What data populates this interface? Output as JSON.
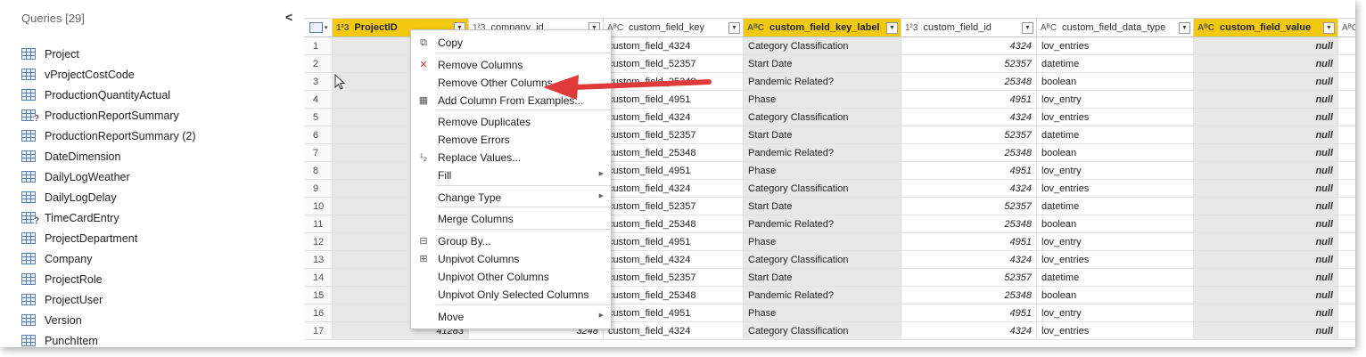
{
  "queries": {
    "header": "Queries [29]",
    "collapse_glyph": "<",
    "items": [
      {
        "label": "Project",
        "icon": "table-icon"
      },
      {
        "label": "vProjectCostCode",
        "icon": "table-icon"
      },
      {
        "label": "ProductionQuantityActual",
        "icon": "table-icon"
      },
      {
        "label": "ProductionReportSummary",
        "icon": "parameter-table-icon"
      },
      {
        "label": "ProductionReportSummary (2)",
        "icon": "table-icon"
      },
      {
        "label": "DateDimension",
        "icon": "table-icon"
      },
      {
        "label": "DailyLogWeather",
        "icon": "table-icon"
      },
      {
        "label": "DailyLogDelay",
        "icon": "table-icon"
      },
      {
        "label": "TimeCardEntry",
        "icon": "parameter-table-icon"
      },
      {
        "label": "ProjectDepartment",
        "icon": "table-icon"
      },
      {
        "label": "Company",
        "icon": "table-icon"
      },
      {
        "label": "ProjectRole",
        "icon": "table-icon"
      },
      {
        "label": "ProjectUser",
        "icon": "table-icon"
      },
      {
        "label": "Version",
        "icon": "table-icon"
      },
      {
        "label": "PunchItem",
        "icon": "table-icon"
      }
    ]
  },
  "grid": {
    "columns": [
      {
        "type": "1²3",
        "name": "ProjectID",
        "selected": true
      },
      {
        "type": "1²3",
        "name": "company_id",
        "selected": false
      },
      {
        "type": "AᴮC",
        "name": "custom_field_key",
        "selected": false
      },
      {
        "type": "AᴮC",
        "name": "custom_field_key_label",
        "selected": true
      },
      {
        "type": "1²3",
        "name": "custom_field_id",
        "selected": false
      },
      {
        "type": "AᴮC",
        "name": "custom_field_data_type",
        "selected": false
      },
      {
        "type": "AᴮC",
        "name": "custom_field_value",
        "selected": true
      },
      {
        "type": "AᴮC",
        "name": "",
        "selected": false
      }
    ],
    "rows": [
      {
        "n": "1",
        "key": "custom_field_4324",
        "label": "Category Classification",
        "id": "4324",
        "dtype": "lov_entries",
        "value": "null"
      },
      {
        "n": "2",
        "key": "custom_field_52357",
        "label": "Start Date",
        "id": "52357",
        "dtype": "datetime",
        "value": "null"
      },
      {
        "n": "3",
        "key": "custom_field_25348",
        "label": "Pandemic Related?",
        "id": "25348",
        "dtype": "boolean",
        "value": "null"
      },
      {
        "n": "4",
        "key": "custom_field_4951",
        "label": "Phase",
        "id": "4951",
        "dtype": "lov_entry",
        "value": "null"
      },
      {
        "n": "5",
        "key": "custom_field_4324",
        "label": "Category Classification",
        "id": "4324",
        "dtype": "lov_entries",
        "value": "null"
      },
      {
        "n": "6",
        "key": "custom_field_52357",
        "label": "Start Date",
        "id": "52357",
        "dtype": "datetime",
        "value": "null"
      },
      {
        "n": "7",
        "key": "custom_field_25348",
        "label": "Pandemic Related?",
        "id": "25348",
        "dtype": "boolean",
        "value": "null"
      },
      {
        "n": "8",
        "key": "custom_field_4951",
        "label": "Phase",
        "id": "4951",
        "dtype": "lov_entry",
        "value": "null"
      },
      {
        "n": "9",
        "key": "custom_field_4324",
        "label": "Category Classification",
        "id": "4324",
        "dtype": "lov_entries",
        "value": "null"
      },
      {
        "n": "10",
        "key": "custom_field_52357",
        "label": "Start Date",
        "id": "52357",
        "dtype": "datetime",
        "value": "null"
      },
      {
        "n": "11",
        "key": "custom_field_25348",
        "label": "Pandemic Related?",
        "id": "25348",
        "dtype": "boolean",
        "value": "null"
      },
      {
        "n": "12",
        "key": "custom_field_4951",
        "label": "Phase",
        "id": "4951",
        "dtype": "lov_entry",
        "value": "null"
      },
      {
        "n": "13",
        "key": "custom_field_4324",
        "label": "Category Classification",
        "id": "4324",
        "dtype": "lov_entries",
        "value": "null"
      },
      {
        "n": "14",
        "key": "custom_field_52357",
        "label": "Start Date",
        "id": "52357",
        "dtype": "datetime",
        "value": "null"
      },
      {
        "n": "15",
        "key": "custom_field_25348",
        "label": "Pandemic Related?",
        "id": "25348",
        "dtype": "boolean",
        "value": "null"
      },
      {
        "n": "16",
        "key": "custom_field_4951",
        "label": "Phase",
        "id": "4951",
        "dtype": "lov_entry",
        "value": "null"
      },
      {
        "n": "17",
        "project": "41283",
        "company": "3248",
        "key": "custom_field_4324",
        "label": "Category Classification",
        "id": "4324",
        "dtype": "lov_entries",
        "value": "null"
      }
    ]
  },
  "context_menu": {
    "items": [
      {
        "label": "Copy",
        "icon": "copy-icon",
        "submenu": false
      },
      {
        "label": "Remove Columns",
        "icon": "remove-columns-icon",
        "submenu": false
      },
      {
        "label": "Remove Other Columns",
        "icon": "",
        "submenu": false
      },
      {
        "label": "Add Column From Examples...",
        "icon": "add-column-examples-icon",
        "submenu": false
      },
      {
        "label": "Remove Duplicates",
        "icon": "",
        "submenu": false
      },
      {
        "label": "Remove Errors",
        "icon": "",
        "submenu": false
      },
      {
        "label": "Replace Values...",
        "icon": "replace-values-icon",
        "submenu": false
      },
      {
        "label": "Fill",
        "icon": "",
        "submenu": true
      },
      {
        "label": "Change Type",
        "icon": "",
        "submenu": true
      },
      {
        "label": "Merge Columns",
        "icon": "",
        "submenu": false
      },
      {
        "label": "Group By...",
        "icon": "group-by-icon",
        "submenu": false
      },
      {
        "label": "Unpivot Columns",
        "icon": "unpivot-columns-icon",
        "submenu": false
      },
      {
        "label": "Unpivot Other Columns",
        "icon": "",
        "submenu": false
      },
      {
        "label": "Unpivot Only Selected Columns",
        "icon": "",
        "submenu": false
      },
      {
        "label": "Move",
        "icon": "",
        "submenu": true
      }
    ]
  },
  "colors": {
    "selected_header": "#f2c811",
    "selected_column": "#e8e8e8",
    "arrow": "#e03a3a"
  }
}
